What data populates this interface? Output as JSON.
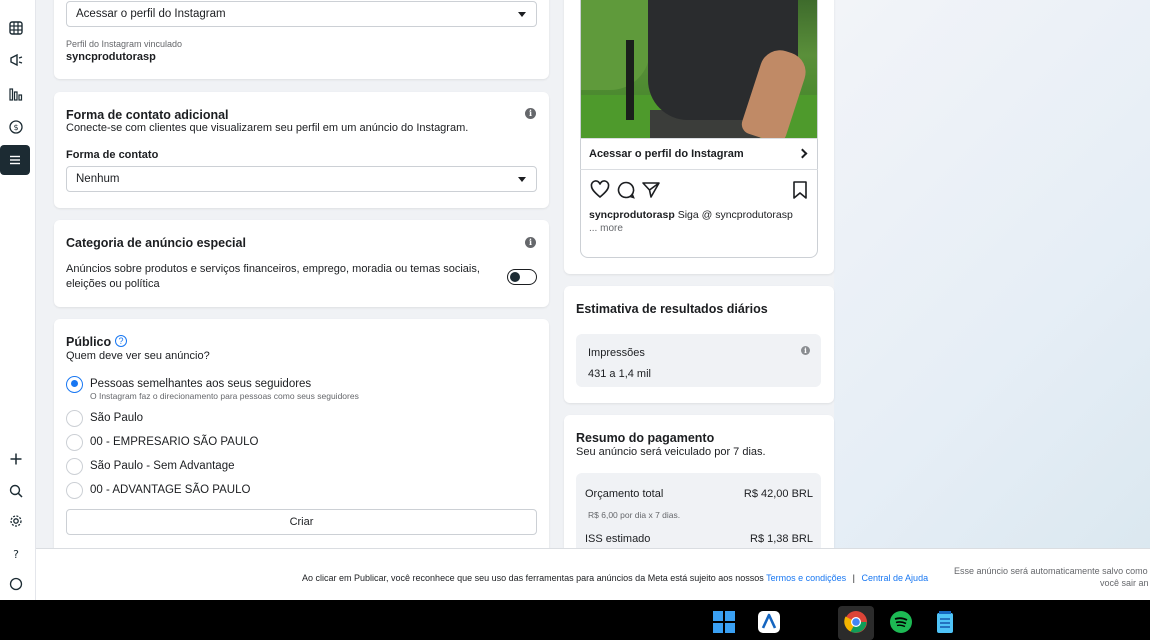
{
  "instagram_profile_card": {
    "cta_select_value": "Acessar o perfil do Instagram",
    "linked_label": "Perfil do Instagram vinculado",
    "linked_profile": "syncprodutorasp"
  },
  "contact_card": {
    "title": "Forma de contato adicional",
    "description": "Conecte-se com clientes que visualizarem seu perfil em um anúncio do Instagram.",
    "field_label": "Forma de contato",
    "select_value": "Nenhum"
  },
  "special_category_card": {
    "title": "Categoria de anúncio especial",
    "description_line1": "Anúncios sobre produtos e serviços financeiros, emprego, moradia ou temas sociais,",
    "description_line2": "eleições ou política"
  },
  "audience_card": {
    "title": "Público",
    "subtitle": "Quem deve ver seu anúncio?",
    "options": [
      {
        "label": "Pessoas semelhantes aos seus seguidores",
        "sub": "O Instagram faz o direcionamento para pessoas como seus seguidores"
      },
      {
        "label": "São Paulo"
      },
      {
        "label": "00 - EMPRESARIO SÃO PAULO"
      },
      {
        "label": "São Paulo - Sem Advantage"
      },
      {
        "label": "00 - ADVANTAGE SÃO PAULO"
      }
    ],
    "create_button": "Criar"
  },
  "preview": {
    "link_label": "Acessar o perfil do Instagram",
    "caption_user": "syncprodutorasp",
    "caption_text": "Siga @ syncprodutorasp",
    "more": "... more"
  },
  "estimate_card": {
    "title": "Estimativa de resultados diários",
    "metric_label": "Impressões",
    "metric_value": "431 a 1,4 mil"
  },
  "payment_card": {
    "title": "Resumo do pagamento",
    "subtitle": "Seu anúncio será veiculado por 7 dias.",
    "budget_label": "Orçamento total",
    "budget_value": "R$ 42,00 BRL",
    "budget_detail": "R$ 6,00 por dia x 7 dias.",
    "tax_label": "ISS estimado",
    "tax_value": "R$ 1,38 BRL"
  },
  "footer": {
    "text": "Ao clicar em Publicar, você reconhece que seu uso das ferramentas para anúncios da Meta está sujeito aos nossos",
    "terms_link": "Termos e condições",
    "separator": "|",
    "help_link": "Central de Ajuda",
    "autosave_line1": "Esse anúncio será automaticamente salvo como",
    "autosave_line2": "você sair an"
  },
  "colors": {
    "accent": "#1877f2",
    "nav_active": "#1c2b33"
  }
}
